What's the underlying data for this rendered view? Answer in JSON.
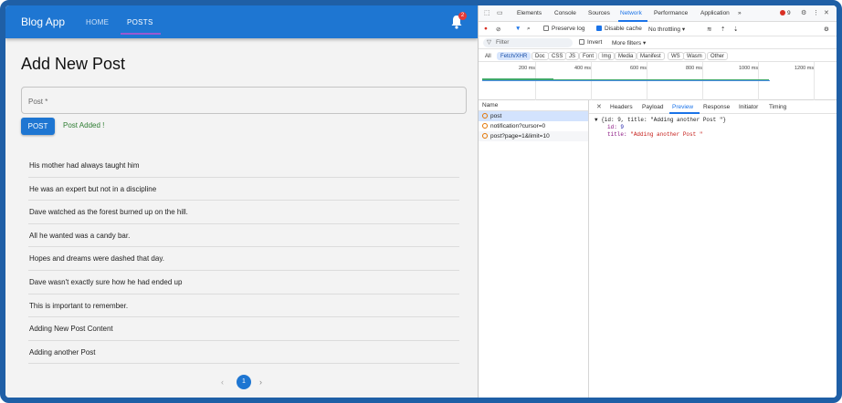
{
  "app": {
    "brand": "Blog App",
    "nav": {
      "home": "HOME",
      "posts": "POSTS"
    },
    "notification_count": "2",
    "page_title": "Add New Post",
    "post_field": {
      "label": "Post *",
      "value": ""
    },
    "post_button": "POST",
    "status_message": "Post Added !",
    "posts": [
      "His mother had always taught him",
      "He was an expert but not in a discipline",
      "Dave watched as the forest burned up on the hill.",
      "All he wanted was a candy bar.",
      "Hopes and dreams were dashed that day.",
      "Dave wasn't exactly sure how he had ended up",
      "This is important to remember.",
      "Adding New Post Content",
      "Adding another Post"
    ],
    "pagination": {
      "prev": "‹",
      "current": "1",
      "next": "›"
    },
    "colors": {
      "appbar": "#1e76d2",
      "success": "#2e7d32"
    }
  },
  "devtools": {
    "tabs": [
      "Elements",
      "Console",
      "Sources",
      "Network",
      "Performance",
      "Application"
    ],
    "active_tab": "Network",
    "more_tabs": "»",
    "error_count": "9",
    "toolbar": {
      "preserve_log": "Preserve log",
      "disable_cache": "Disable cache",
      "throttling": "No throttling"
    },
    "filter": {
      "placeholder": "Filter",
      "invert": "Invert",
      "more_filters": "More filters ▾"
    },
    "types": [
      "All",
      "Fetch/XHR",
      "Doc",
      "CSS",
      "JS",
      "Font",
      "Img",
      "Media",
      "Manifest",
      "WS",
      "Wasm",
      "Other"
    ],
    "active_type": "Fetch/XHR",
    "timeline_ticks": [
      "200 ms",
      "400 ms",
      "600 ms",
      "800 ms",
      "1000 ms",
      "1200 ms"
    ],
    "requests_header": "Name",
    "requests": [
      "post",
      "notification?cursor=0",
      "post?page=1&limit=10"
    ],
    "detail_tabs": [
      "Headers",
      "Payload",
      "Preview",
      "Response",
      "Initiator",
      "Timing"
    ],
    "active_detail_tab": "Preview",
    "preview": {
      "summary": "▼ {id: 9, title: \"Adding another Post \"}",
      "id_key": "id:",
      "id_val": "9",
      "title_key": "title:",
      "title_val": "\"Adding another Post \""
    }
  }
}
